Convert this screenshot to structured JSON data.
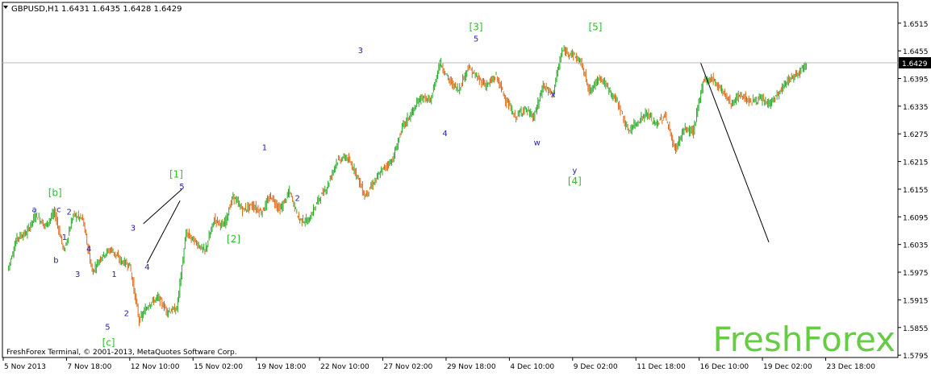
{
  "header": {
    "symbol_timeframe": "GBPUSD,H1",
    "ohlc": "1.6431 1.6435 1.6428 1.6429"
  },
  "footer": {
    "copyright": "FreshForex Terminal, © 2001-2013, MetaQuotes Software Corp."
  },
  "watermark": "FreshForex",
  "colors": {
    "background": "#ffffff",
    "bull_candle": "#22aa22",
    "bear_candle": "#dd6611",
    "wave_label_primary": "#33bb33",
    "wave_label_minor": "#2222aa",
    "current_price_box": "#000000",
    "watermark": "#66cc44"
  },
  "chart_data": {
    "type": "line",
    "symbol": "GBPUSD",
    "timeframe": "H1",
    "current_price": "1.6429",
    "y_ticks": [
      "1.6515",
      "1.6455",
      "1.6395",
      "1.6335",
      "1.6275",
      "1.6215",
      "1.6155",
      "1.6095",
      "1.6035",
      "1.5975",
      "1.5915",
      "1.5855",
      "1.5795"
    ],
    "ylim": [
      1.579,
      1.656
    ],
    "x_ticks": [
      "5 Nov 2013",
      "7 Nov 18:00",
      "12 Nov 10:00",
      "15 Nov 02:00",
      "19 Nov 18:00",
      "22 Nov 10:00",
      "27 Nov 02:00",
      "29 Nov 18:00",
      "4 Dec 10:00",
      "9 Dec 02:00",
      "11 Dec 18:00",
      "16 Dec 10:00",
      "19 Dec 02:00",
      "23 Dec 18:00"
    ],
    "price_path": [
      {
        "i": 0,
        "y": 1.598
      },
      {
        "i": 1,
        "y": 1.605
      },
      {
        "i": 2,
        "y": 1.606
      },
      {
        "i": 3,
        "y": 1.61
      },
      {
        "i": 4,
        "y": 1.6075
      },
      {
        "i": 5,
        "y": 1.6105
      },
      {
        "i": 6,
        "y": 1.602
      },
      {
        "i": 7,
        "y": 1.61
      },
      {
        "i": 8,
        "y": 1.609
      },
      {
        "i": 9,
        "y": 1.5975
      },
      {
        "i": 10,
        "y": 1.601
      },
      {
        "i": 11,
        "y": 1.6025
      },
      {
        "i": 12,
        "y": 1.6
      },
      {
        "i": 13,
        "y": 1.599
      },
      {
        "i": 14,
        "y": 1.587
      },
      {
        "i": 15,
        "y": 1.5905
      },
      {
        "i": 16,
        "y": 1.592
      },
      {
        "i": 17,
        "y": 1.589
      },
      {
        "i": 18,
        "y": 1.5895
      },
      {
        "i": 19,
        "y": 1.606
      },
      {
        "i": 20,
        "y": 1.604
      },
      {
        "i": 21,
        "y": 1.602
      },
      {
        "i": 22,
        "y": 1.609
      },
      {
        "i": 23,
        "y": 1.6075
      },
      {
        "i": 24,
        "y": 1.614
      },
      {
        "i": 25,
        "y": 1.611
      },
      {
        "i": 26,
        "y": 1.612
      },
      {
        "i": 27,
        "y": 1.6105
      },
      {
        "i": 28,
        "y": 1.614
      },
      {
        "i": 29,
        "y": 1.611
      },
      {
        "i": 30,
        "y": 1.615
      },
      {
        "i": 31,
        "y": 1.609
      },
      {
        "i": 32,
        "y": 1.6085
      },
      {
        "i": 33,
        "y": 1.613
      },
      {
        "i": 34,
        "y": 1.616
      },
      {
        "i": 35,
        "y": 1.6215
      },
      {
        "i": 36,
        "y": 1.6225
      },
      {
        "i": 37,
        "y": 1.6195
      },
      {
        "i": 38,
        "y": 1.614
      },
      {
        "i": 39,
        "y": 1.617
      },
      {
        "i": 40,
        "y": 1.62
      },
      {
        "i": 41,
        "y": 1.622
      },
      {
        "i": 42,
        "y": 1.629
      },
      {
        "i": 43,
        "y": 1.632
      },
      {
        "i": 44,
        "y": 1.6355
      },
      {
        "i": 45,
        "y": 1.6345
      },
      {
        "i": 46,
        "y": 1.643
      },
      {
        "i": 47,
        "y": 1.639
      },
      {
        "i": 48,
        "y": 1.637
      },
      {
        "i": 49,
        "y": 1.642
      },
      {
        "i": 50,
        "y": 1.6395
      },
      {
        "i": 51,
        "y": 1.638
      },
      {
        "i": 52,
        "y": 1.64
      },
      {
        "i": 53,
        "y": 1.635
      },
      {
        "i": 54,
        "y": 1.631
      },
      {
        "i": 55,
        "y": 1.633
      },
      {
        "i": 56,
        "y": 1.631
      },
      {
        "i": 57,
        "y": 1.638
      },
      {
        "i": 58,
        "y": 1.636
      },
      {
        "i": 59,
        "y": 1.6455
      },
      {
        "i": 60,
        "y": 1.645
      },
      {
        "i": 61,
        "y": 1.643
      },
      {
        "i": 62,
        "y": 1.6365
      },
      {
        "i": 63,
        "y": 1.64
      },
      {
        "i": 64,
        "y": 1.637
      },
      {
        "i": 65,
        "y": 1.634
      },
      {
        "i": 66,
        "y": 1.628
      },
      {
        "i": 67,
        "y": 1.63
      },
      {
        "i": 68,
        "y": 1.632
      },
      {
        "i": 69,
        "y": 1.6295
      },
      {
        "i": 70,
        "y": 1.6315
      },
      {
        "i": 71,
        "y": 1.624
      },
      {
        "i": 72,
        "y": 1.6285
      },
      {
        "i": 73,
        "y": 1.628
      },
      {
        "i": 74,
        "y": 1.639
      },
      {
        "i": 75,
        "y": 1.6395
      },
      {
        "i": 76,
        "y": 1.637
      },
      {
        "i": 77,
        "y": 1.634
      },
      {
        "i": 78,
        "y": 1.636
      },
      {
        "i": 79,
        "y": 1.6345
      },
      {
        "i": 80,
        "y": 1.635
      },
      {
        "i": 81,
        "y": 1.634
      },
      {
        "i": 82,
        "y": 1.636
      },
      {
        "i": 83,
        "y": 1.639
      },
      {
        "i": 84,
        "y": 1.6405
      },
      {
        "i": 85,
        "y": 1.643
      }
    ],
    "wave_labels": [
      {
        "text": "[b]",
        "i": 5,
        "y": 1.614,
        "style": "primary"
      },
      {
        "text": "[c]",
        "i": 10.7,
        "y": 1.5815,
        "style": "primary"
      },
      {
        "text": "[1]",
        "i": 17.9,
        "y": 1.618,
        "style": "primary"
      },
      {
        "text": "[2]",
        "i": 24,
        "y": 1.604,
        "style": "primary"
      },
      {
        "text": "[3]",
        "i": 49.8,
        "y": 1.65,
        "style": "primary"
      },
      {
        "text": "[4]",
        "i": 60.3,
        "y": 1.6165,
        "style": "primary"
      },
      {
        "text": "[5]",
        "i": 62.5,
        "y": 1.65,
        "style": "primary"
      },
      {
        "text": "a",
        "i": 2.8,
        "y": 1.6105,
        "style": "minor"
      },
      {
        "text": "c",
        "i": 5.4,
        "y": 1.6105,
        "style": "minor"
      },
      {
        "text": "2",
        "i": 6.5,
        "y": 1.61,
        "style": "minor"
      },
      {
        "text": "1",
        "i": 6,
        "y": 1.6045,
        "style": "minor"
      },
      {
        "text": "b",
        "i": 5.1,
        "y": 1.5995,
        "style": "minor"
      },
      {
        "text": "4",
        "i": 8.6,
        "y": 1.602,
        "style": "minor"
      },
      {
        "text": "3",
        "i": 7.4,
        "y": 1.5965,
        "style": "minor"
      },
      {
        "text": "1",
        "i": 11.3,
        "y": 1.5965,
        "style": "minor"
      },
      {
        "text": "5",
        "i": 10.6,
        "y": 1.585,
        "style": "minor"
      },
      {
        "text": "2",
        "i": 12.6,
        "y": 1.588,
        "style": "minor"
      },
      {
        "text": "3",
        "i": 13.3,
        "y": 1.6065,
        "style": "minor"
      },
      {
        "text": "4",
        "i": 14.8,
        "y": 1.598,
        "style": "minor"
      },
      {
        "text": "5",
        "i": 18.5,
        "y": 1.6155,
        "style": "minor"
      },
      {
        "text": "1",
        "i": 27.3,
        "y": 1.624,
        "style": "minor"
      },
      {
        "text": "2",
        "i": 30.8,
        "y": 1.613,
        "style": "minor"
      },
      {
        "text": "3",
        "i": 37.5,
        "y": 1.645,
        "style": "minor"
      },
      {
        "text": "4",
        "i": 46.5,
        "y": 1.627,
        "style": "minor"
      },
      {
        "text": "5",
        "i": 49.8,
        "y": 1.6475,
        "style": "minor"
      },
      {
        "text": "w",
        "i": 56.3,
        "y": 1.625,
        "style": "minor"
      },
      {
        "text": "x",
        "i": 58,
        "y": 1.6355,
        "style": "minor"
      },
      {
        "text": "y",
        "i": 60.3,
        "y": 1.619,
        "style": "minor"
      }
    ],
    "channel_lines": [
      {
        "from": {
          "i": 14.4,
          "y": 1.608
        },
        "to": {
          "i": 18.5,
          "y": 1.6155
        }
      },
      {
        "from": {
          "i": 14.8,
          "y": 1.5995
        },
        "to": {
          "i": 18.3,
          "y": 1.613
        }
      }
    ],
    "forecast_line": {
      "from": {
        "i": 73,
        "y": 1.643
      },
      "to": {
        "i": 78,
        "y": 1.604
      }
    },
    "title": "",
    "xlabel": "",
    "ylabel": ""
  }
}
